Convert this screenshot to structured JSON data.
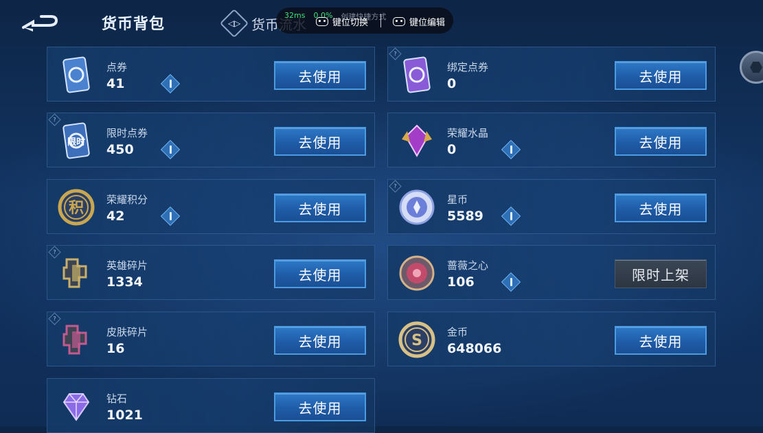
{
  "header": {
    "title": "货币背包",
    "flow_tab": "货币流水",
    "flow_icon_glyph": "◁▷"
  },
  "overlay": {
    "ping": "32ms",
    "loss": "0.0%",
    "extra": "创建快捷方式",
    "switch_label": "键位切换",
    "edit_label": "键位编辑"
  },
  "items": [
    {
      "name": "点券",
      "value": "41",
      "button": "去使用",
      "has_plus": true,
      "has_q": false,
      "icon": "coupon-icon",
      "color": "#4b82d0"
    },
    {
      "name": "绑定点券",
      "value": "0",
      "button": "去使用",
      "has_plus": false,
      "has_q": true,
      "icon": "bound-coupon-icon",
      "color": "#8a5bd6"
    },
    {
      "name": "限时点券",
      "value": "450",
      "button": "去使用",
      "has_plus": true,
      "has_q": true,
      "icon": "limited-coupon-icon",
      "color": "#3d6fba",
      "icon_text": "限时"
    },
    {
      "name": "荣耀水晶",
      "value": "0",
      "button": "去使用",
      "has_plus": true,
      "has_q": false,
      "icon": "glory-crystal-icon",
      "color": "#a33cc7"
    },
    {
      "name": "荣耀积分",
      "value": "42",
      "button": "去使用",
      "has_plus": true,
      "has_q": false,
      "icon": "glory-points-icon",
      "color": "#c9a650",
      "icon_text": "积"
    },
    {
      "name": "星币",
      "value": "5589",
      "button": "去使用",
      "has_plus": true,
      "has_q": true,
      "icon": "star-coin-icon",
      "color": "#6b7fd9"
    },
    {
      "name": "英雄碎片",
      "value": "1334",
      "button": "去使用",
      "has_plus": false,
      "has_q": true,
      "icon": "hero-shard-icon",
      "color": "#c9b06a"
    },
    {
      "name": "蔷薇之心",
      "value": "106",
      "button": "限时上架",
      "has_plus": true,
      "has_q": false,
      "icon": "rose-heart-icon",
      "color": "#c24a6a",
      "dark": true
    },
    {
      "name": "皮肤碎片",
      "value": "16",
      "button": "去使用",
      "has_plus": false,
      "has_q": true,
      "icon": "skin-shard-icon",
      "color": "#c25a8f"
    },
    {
      "name": "金币",
      "value": "648066",
      "button": "去使用",
      "has_plus": false,
      "has_q": false,
      "icon": "gold-coin-icon",
      "color": "#d8c186",
      "icon_text": "S"
    },
    {
      "name": "钻石",
      "value": "1021",
      "button": "去使用",
      "has_plus": false,
      "has_q": false,
      "icon": "diamond-icon",
      "color": "#8b6be8"
    }
  ]
}
